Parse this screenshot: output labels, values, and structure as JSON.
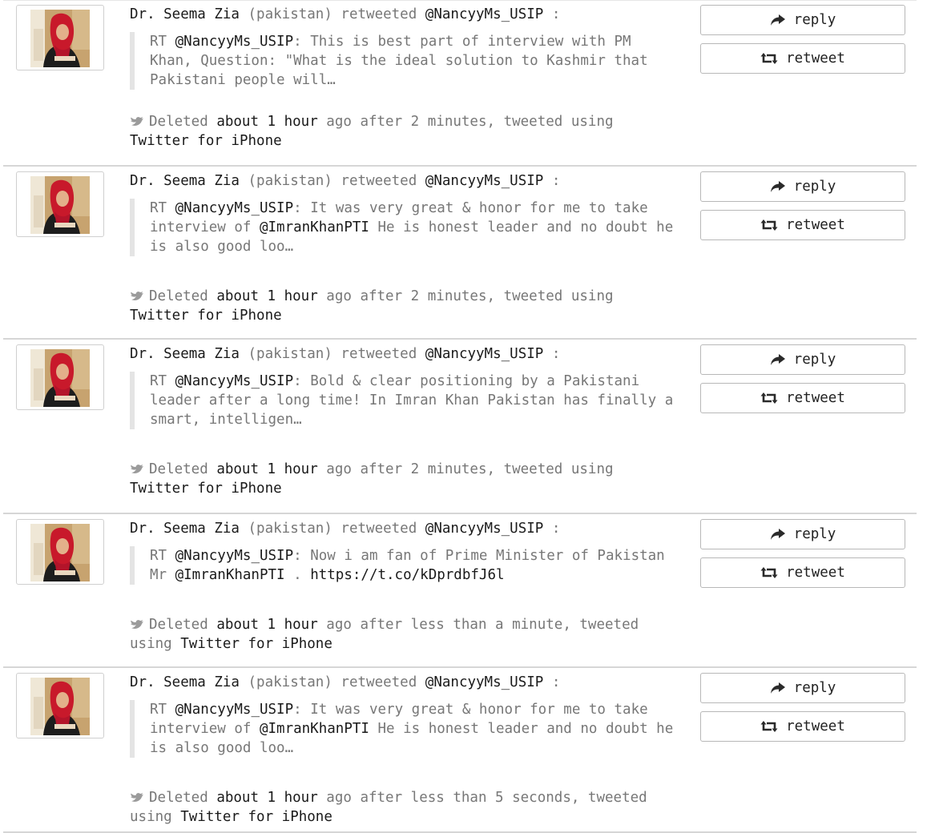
{
  "labels": {
    "retweeted": "retweeted",
    "deleted": "Deleted",
    "ago_after": "ago after",
    "tweeted_using": "tweeted using",
    "reply": "reply",
    "retweet": "retweet"
  },
  "icons": {
    "reply": "reply-arrow-icon",
    "retweet": "retweet-icon",
    "deleted": "deleted-bird-icon",
    "avatar": "profile-photo"
  },
  "tweets": [
    {
      "author": "Dr. Seema Zia",
      "country": "(pakistan)",
      "retweeted_from": "@NancyyMs_USIP",
      "rt_prefix": "RT",
      "rt_handle": "@NancyyMs_USIP",
      "text_a": ": This is best part of interview with PM Khan, Question: \"What is the ideal solution to Kashmir that Pakistani people will…",
      "mention": "",
      "text_b": "",
      "link": "",
      "deleted_time": "about 1 hour",
      "duration": "2 minutes,",
      "using": "",
      "client": "Twitter for iPhone"
    },
    {
      "author": "Dr. Seema Zia",
      "country": "(pakistan)",
      "retweeted_from": "@NancyyMs_USIP",
      "rt_prefix": "RT",
      "rt_handle": "@NancyyMs_USIP",
      "text_a": ": It was very great & honor for me to take interview of ",
      "mention": "@ImranKhanPTI",
      "text_b": " He is honest leader and no doubt he is also good loo…",
      "link": "",
      "deleted_time": "about 1 hour",
      "duration": "2 minutes,",
      "using": "",
      "client": "Twitter for iPhone"
    },
    {
      "author": "Dr. Seema Zia",
      "country": "(pakistan)",
      "retweeted_from": "@NancyyMs_USIP",
      "rt_prefix": "RT",
      "rt_handle": "@NancyyMs_USIP",
      "text_a": ": Bold & clear positioning by a Pakistani leader after a long time! In Imran Khan Pakistan has finally a smart, intelligen…",
      "mention": "",
      "text_b": "",
      "link": "",
      "deleted_time": "about 1 hour",
      "duration": "2 minutes,",
      "using": "",
      "client": "Twitter for iPhone"
    },
    {
      "author": "Dr. Seema Zia",
      "country": "(pakistan)",
      "retweeted_from": "@NancyyMs_USIP",
      "rt_prefix": "RT",
      "rt_handle": "@NancyyMs_USIP",
      "text_a": ": Now i am fan of Prime Minister of Pakistan Mr ",
      "mention": "@ImranKhanPTI",
      "text_b": " . ",
      "link": "https://t.co/kDprdbfJ6l",
      "deleted_time": "about 1 hour",
      "duration": "less than a minute, tweeted",
      "using": "using",
      "client": "Twitter for iPhone"
    },
    {
      "author": "Dr. Seema Zia",
      "country": "(pakistan)",
      "retweeted_from": "@NancyyMs_USIP",
      "rt_prefix": "RT",
      "rt_handle": "@NancyyMs_USIP",
      "text_a": ": It was very great & honor for me to take interview of ",
      "mention": "@ImranKhanPTI",
      "text_b": " He is honest leader and no doubt he is also good loo…",
      "link": "",
      "deleted_time": "about 1 hour",
      "duration": "less than 5 seconds, tweeted",
      "using": "using",
      "client": "Twitter for iPhone"
    }
  ]
}
